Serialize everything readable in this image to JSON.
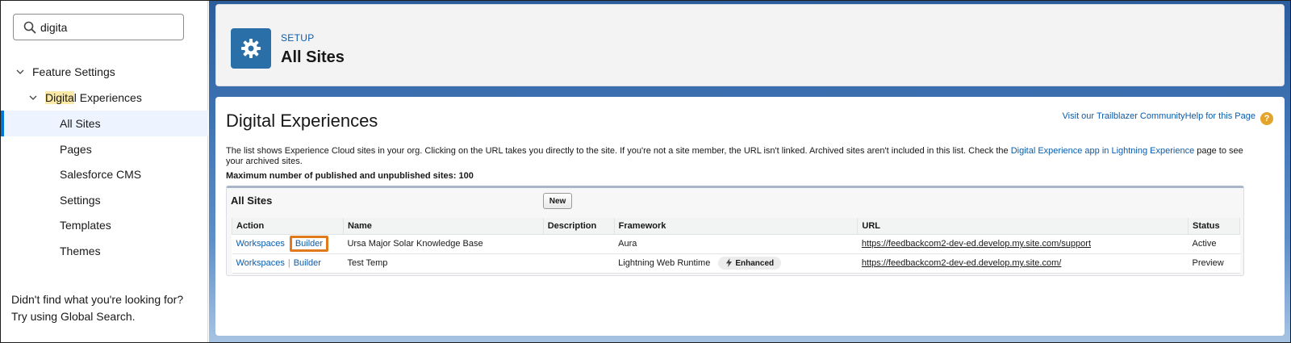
{
  "sidebar": {
    "search_value": "digita",
    "tree": [
      {
        "label": "Feature Settings"
      },
      {
        "label_hl": "Digita",
        "label_rest": "l Experiences"
      },
      {
        "label": "All Sites"
      },
      {
        "label": "Pages"
      },
      {
        "label": "Salesforce CMS"
      },
      {
        "label": "Settings"
      },
      {
        "label": "Templates"
      },
      {
        "label": "Themes"
      }
    ],
    "help_line1": "Didn't find what you're looking for?",
    "help_line2": "Try using Global Search."
  },
  "header": {
    "eyebrow": "SETUP",
    "title": "All Sites"
  },
  "content": {
    "title": "Digital Experiences",
    "link_trailblazer": "Visit our Trailblazer Community",
    "link_help": "Help for this Page",
    "help_badge": "?",
    "desc_text": "The list shows Experience Cloud sites in your org. Clicking on the URL takes you directly to the site. If you're not a site member, the URL isn't linked. Archived sites aren't included in this list. Check the ",
    "desc_link": "Digital Experience app in Lightning Experience",
    "desc_end": " page to see your archived sites.",
    "max_line": "Maximum number of published and unpublished sites: 100",
    "list": {
      "title": "All Sites",
      "new_label": "New",
      "columns": [
        "Action",
        "Name",
        "Description",
        "Framework",
        "URL",
        "Status"
      ],
      "rows": [
        {
          "workspaces": "Workspaces",
          "builder": "Builder",
          "name": "Ursa Major Solar Knowledge Base",
          "description": "",
          "framework": "Aura",
          "badge": "",
          "url": "https://feedbackcom2-dev-ed.develop.my.site.com/support",
          "status": "Active"
        },
        {
          "workspaces": "Workspaces",
          "sep": "|",
          "builder": "Builder",
          "name": "Test Temp",
          "description": "",
          "framework": "Lightning Web Runtime",
          "badge": "Enhanced",
          "url": "https://feedbackcom2-dev-ed.develop.my.site.com/",
          "status": "Preview"
        }
      ]
    }
  },
  "colors": {
    "brand_blue": "#0b5cab",
    "selected_bg": "#eef4ff",
    "highlight": "#fbe9a8",
    "focus_outline": "#e07a1c"
  }
}
